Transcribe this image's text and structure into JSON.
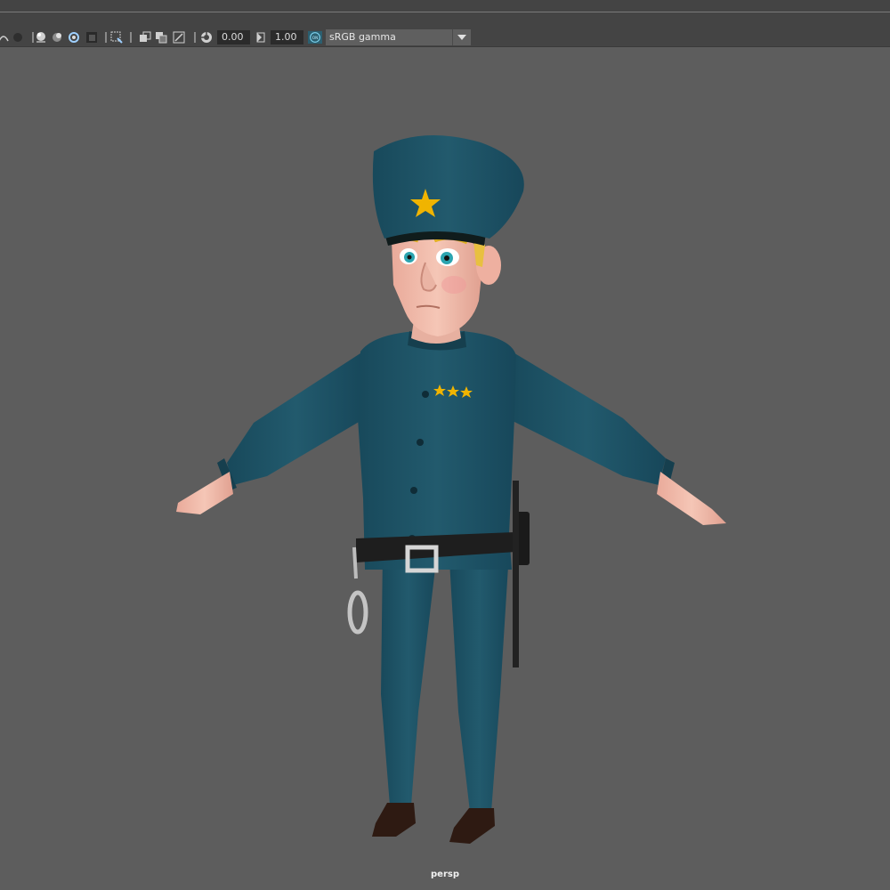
{
  "toolbar": {
    "exposure_value": "0.00",
    "gamma_value": "1.00",
    "color_management_toggle": "ON",
    "color_space": "sRGB gamma"
  },
  "viewport": {
    "camera_name": "persp"
  },
  "icons": [
    "curve-icon",
    "sphere-dark-icon",
    "sphere-shaded-icon",
    "sphere-textured-icon",
    "lighting-icon",
    "frame-icon",
    "isolate-icon",
    "xray-icon",
    "xray-joints-icon",
    "backface-icon",
    "exposure-icon",
    "gamma-icon",
    "color-management-icon"
  ],
  "colors": {
    "background": "#5d5d5d",
    "toolbar": "#444444",
    "uniform": "#1f5366",
    "star_gold": "#f0b400",
    "accent_cyan": "#39a0c0"
  }
}
